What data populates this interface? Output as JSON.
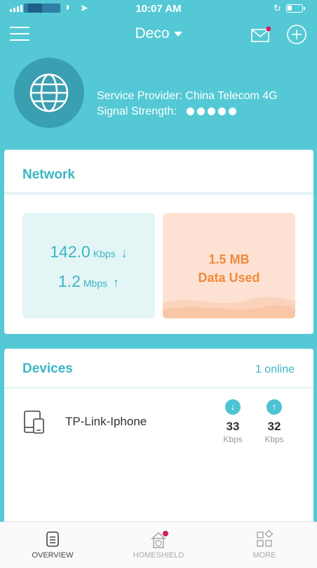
{
  "status_bar": {
    "time": "10:07 AM"
  },
  "header": {
    "title": "Deco"
  },
  "provider": {
    "service_provider": "Service Provider: China Telecom 4G",
    "signal_label": "Signal Strength:",
    "signal_bars": 5
  },
  "network": {
    "title": "Network",
    "download": {
      "value": "142.0",
      "unit": "Kbps"
    },
    "upload": {
      "value": "1.2",
      "unit": "Mbps"
    },
    "data_amount": "1.5 MB",
    "data_label": "Data Used"
  },
  "devices": {
    "title": "Devices",
    "online": "1 online",
    "items": [
      {
        "name": "TP-Link-Iphone",
        "down_value": "33",
        "down_unit": "Kbps",
        "up_value": "32",
        "up_unit": "Kbps"
      }
    ]
  },
  "tabs": [
    {
      "label": "OVERVIEW"
    },
    {
      "label": "HOMESHIELD"
    },
    {
      "label": "MORE"
    }
  ],
  "colors": {
    "background": "#54c9d5",
    "accent": "#3bb6c5",
    "data_orange": "#f08a3c",
    "notification_dot": "#d81b60"
  }
}
